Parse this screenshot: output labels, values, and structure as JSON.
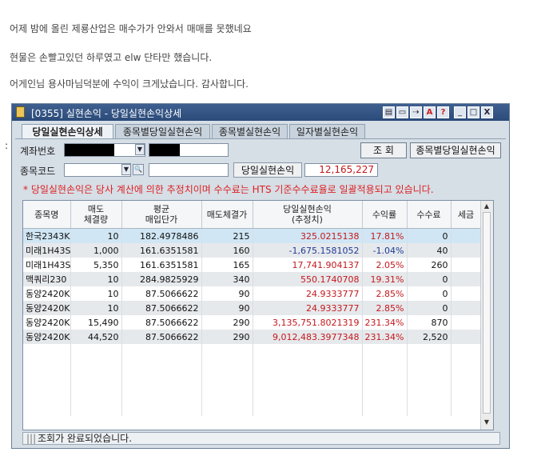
{
  "post": {
    "line1": "어제 밤에 올린 제룡산업은 매수가가 안와서 매매를 못했네요",
    "line2": "현물은 손빨고있던 하루였고 elw 단타만 했습니다.",
    "line3": "어게인님 용사마님덕분에 수익이 크게났습니다. 감사합니다."
  },
  "window": {
    "title": "[0355] 실현손익 - 당일실현손익상세",
    "controls": {
      "minimize": "_",
      "maximize": "□",
      "close": "X",
      "help": "?",
      "font": "A"
    }
  },
  "tabs": [
    {
      "label": "당일실현손익상세"
    },
    {
      "label": "종목별당일실현손익"
    },
    {
      "label": "종목별실현손익"
    },
    {
      "label": "일자별실현손익"
    }
  ],
  "form": {
    "account_label": "계좌번호",
    "stock_code_label": "종목코드",
    "query_button": "조  회",
    "by_stock_button": "종목별당일실현손익",
    "daily_pnl_label": "당일실현손익",
    "daily_pnl_value": "12,165,227"
  },
  "notice": "* 당일실현손익은 당사 계산에 의한 추정치이며 수수료는 HTS 기준수수료율로 일괄적용되고 있습니다.",
  "table": {
    "headers": [
      "종목명",
      "매도\n체결량",
      "평균\n매입단가",
      "매도체결가",
      "당일실현손익\n(추정치)",
      "수익률",
      "수수료",
      "세금"
    ],
    "rows": [
      {
        "name": "한국2343K",
        "qty": "10",
        "avg": "182.4978486",
        "sell": "215",
        "pnl": "325.0215138",
        "rate": "17.81%",
        "fee": "0",
        "tax": "",
        "tone": "red"
      },
      {
        "name": "미래1H43S",
        "qty": "1,000",
        "avg": "161.6351581",
        "sell": "160",
        "pnl": "-1,675.1581052",
        "rate": "-1.04%",
        "fee": "40",
        "tax": "",
        "tone": "blue"
      },
      {
        "name": "미래1H43S",
        "qty": "5,350",
        "avg": "161.6351581",
        "sell": "165",
        "pnl": "17,741.904137",
        "rate": "2.05%",
        "fee": "260",
        "tax": "",
        "tone": "red"
      },
      {
        "name": "맥쿼리230",
        "qty": "10",
        "avg": "284.9825929",
        "sell": "340",
        "pnl": "550.1740708",
        "rate": "19.31%",
        "fee": "0",
        "tax": "",
        "tone": "red"
      },
      {
        "name": "동양2420K",
        "qty": "10",
        "avg": "87.5066622",
        "sell": "90",
        "pnl": "24.9333777",
        "rate": "2.85%",
        "fee": "0",
        "tax": "",
        "tone": "red"
      },
      {
        "name": "동양2420K",
        "qty": "10",
        "avg": "87.5066622",
        "sell": "90",
        "pnl": "24.9333777",
        "rate": "2.85%",
        "fee": "0",
        "tax": "",
        "tone": "red"
      },
      {
        "name": "동양2420K",
        "qty": "15,490",
        "avg": "87.5066622",
        "sell": "290",
        "pnl": "3,135,751.8021319",
        "rate": "231.34%",
        "fee": "870",
        "tax": "",
        "tone": "red"
      },
      {
        "name": "동양2420K",
        "qty": "44,520",
        "avg": "87.5066622",
        "sell": "290",
        "pnl": "9,012,483.3977348",
        "rate": "231.34%",
        "fee": "2,520",
        "tax": "",
        "tone": "red"
      }
    ]
  },
  "status": {
    "message": "조회가 완료되었습니다."
  }
}
